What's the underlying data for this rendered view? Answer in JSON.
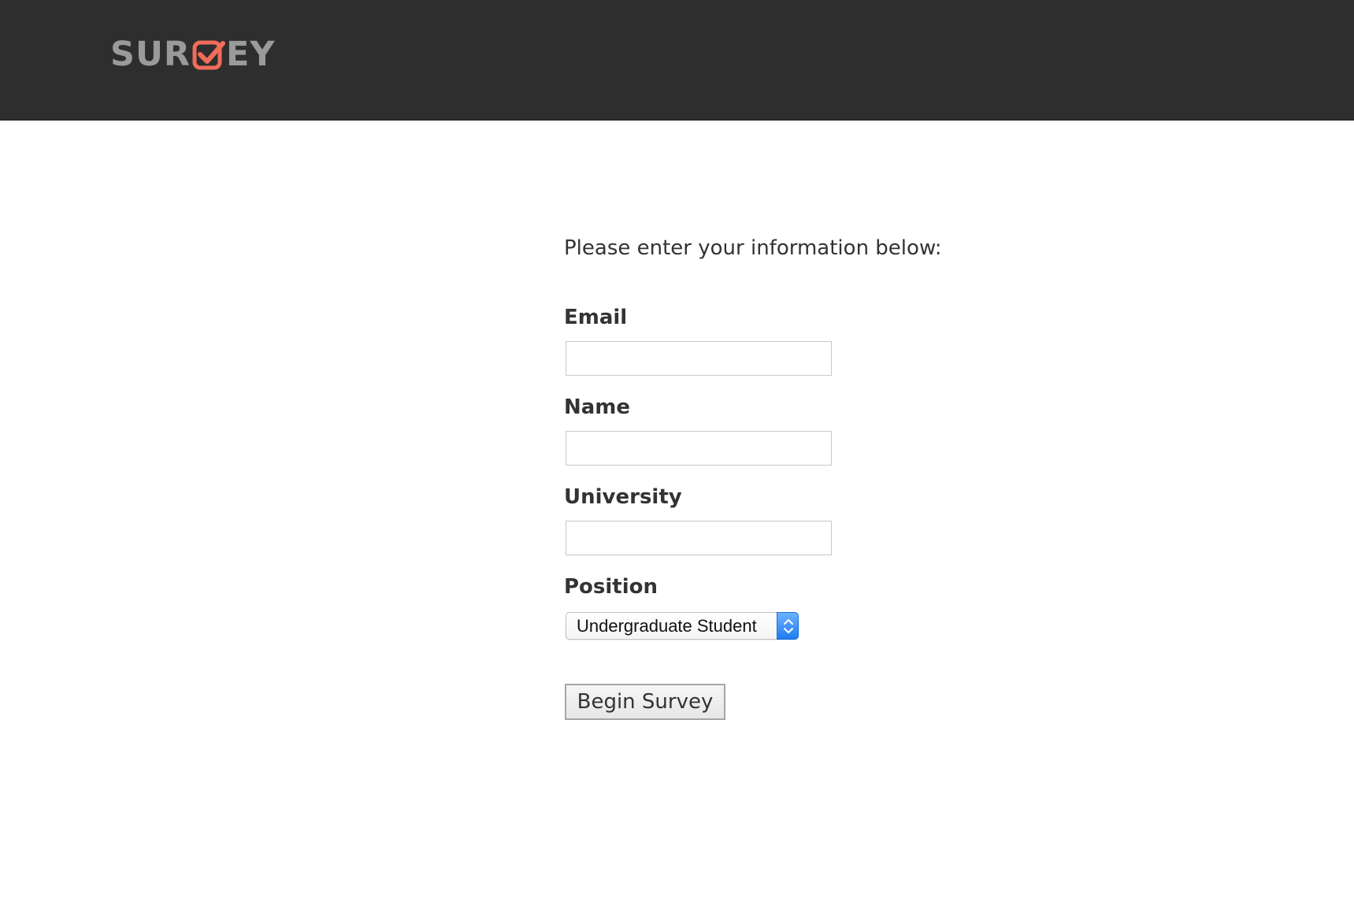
{
  "header": {
    "logo": {
      "text_before": "SUR",
      "text_after": "EY",
      "mark_icon": "checkbox-check-icon",
      "mark_color": "#f26c5a",
      "text_color": "#9a9a9a"
    },
    "background": "#2e2e2e"
  },
  "form": {
    "intro": "Please enter your information below:",
    "fields": [
      {
        "label": "Email",
        "value": "",
        "placeholder": ""
      },
      {
        "label": "Name",
        "value": "",
        "placeholder": ""
      },
      {
        "label": "University",
        "value": "",
        "placeholder": ""
      }
    ],
    "position": {
      "label": "Position",
      "selected": "Undergraduate Student",
      "accent": "#1f7cf0"
    },
    "submit_label": "Begin Survey"
  }
}
